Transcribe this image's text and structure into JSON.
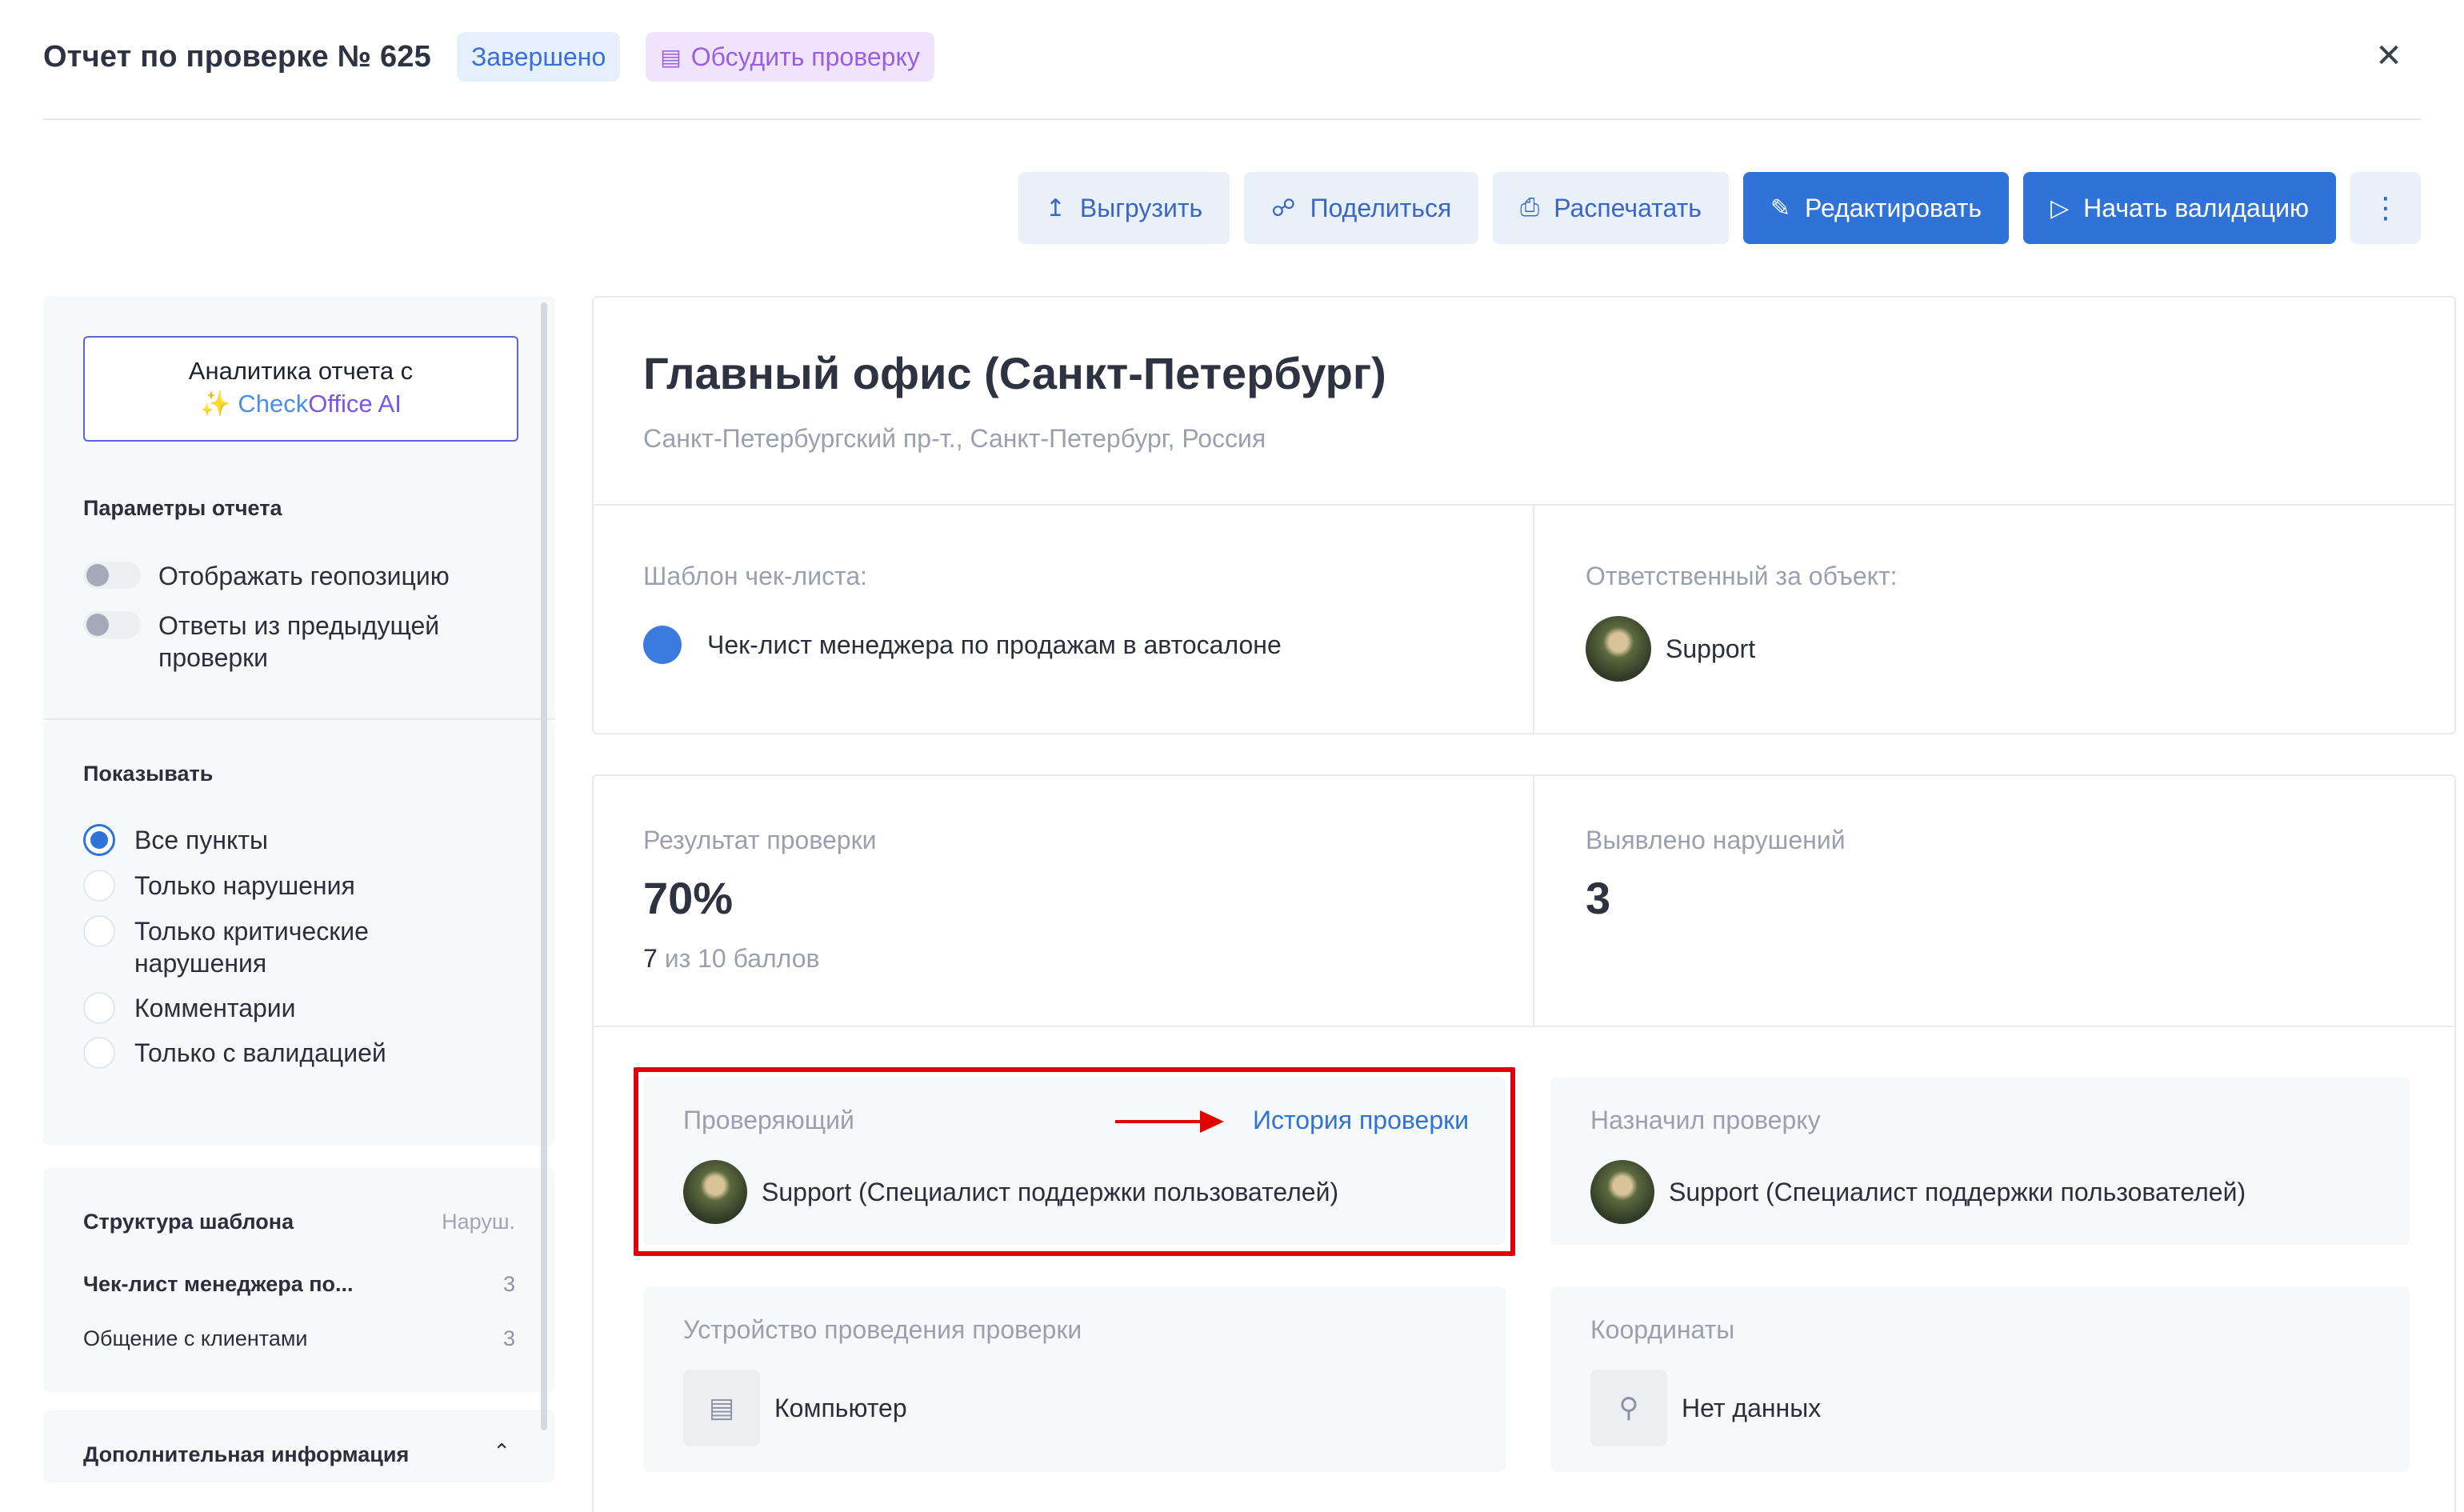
{
  "header": {
    "title": "Отчет по проверке № 625",
    "status": "Завершено",
    "discuss": "Обсудить проверку"
  },
  "toolbar": {
    "export": "Выгрузить",
    "share": "Поделиться",
    "print": "Распечатать",
    "edit": "Редактировать",
    "validate": "Начать валидацию"
  },
  "sidebar": {
    "ai_line1": "Аналитика отчета с",
    "ai_check": "Check",
    "ai_office": "Office AI",
    "params_title": "Параметры отчета",
    "toggle_geo": "Отображать геопозицию",
    "toggle_prev": "Ответы из предыдущей проверки",
    "show_title": "Показывать",
    "radios": [
      "Все пункты",
      "Только нарушения",
      "Только критические нарушения",
      "Комментарии",
      "Только с валидацией"
    ],
    "struct_title": "Структура шаблона",
    "struct_col": "Наруш.",
    "struct_rows": [
      {
        "name": "Чек-лист менеджера по...",
        "count": "3"
      },
      {
        "name": "Общение с клиентами",
        "count": "3"
      }
    ],
    "additional": "Дополнительная информация"
  },
  "office": {
    "name": "Главный офис (Санкт-Петербург)",
    "address": "Санкт-Петербургский пр-т., Санкт-Петербург, Россия"
  },
  "template": {
    "label": "Шаблон чек-листа:",
    "value": "Чек-лист менеджера по продажам в автосалоне"
  },
  "responsible": {
    "label": "Ответственный за объект:",
    "value": "Support"
  },
  "result": {
    "label": "Результат проверки",
    "value": "70%",
    "score_num": "7",
    "score_rest": "из 10 баллов"
  },
  "violations": {
    "label": "Выявлено нарушений",
    "value": "3"
  },
  "inspector": {
    "label": "Проверяющий",
    "history": "История проверки",
    "value": "Support (Специалист поддержки пользователей)"
  },
  "assigned": {
    "label": "Назначил проверку",
    "value": "Support (Специалист поддержки пользователей)"
  },
  "device": {
    "label": "Устройство проведения проверки",
    "value": "Компьютер"
  },
  "coords": {
    "label": "Координаты",
    "value": "Нет данных"
  }
}
